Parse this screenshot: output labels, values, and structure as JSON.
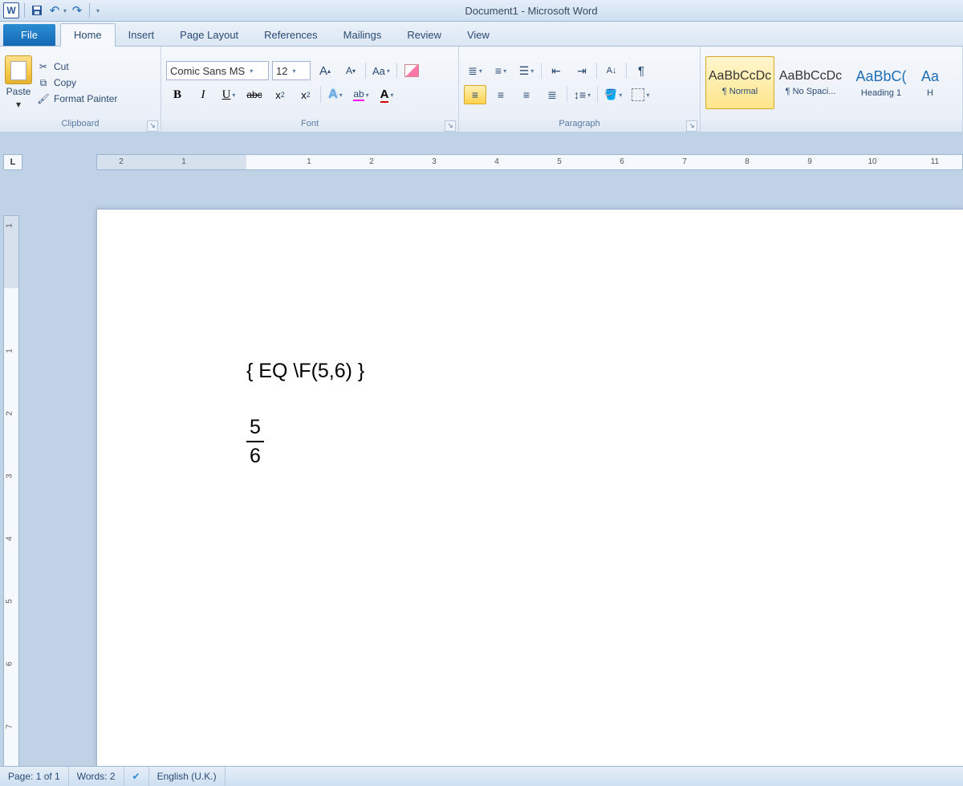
{
  "app": {
    "title": "Document1 - Microsoft Word"
  },
  "qat": {
    "word_letter": "W"
  },
  "tabs": {
    "file": "File",
    "items": [
      "Home",
      "Insert",
      "Page Layout",
      "References",
      "Mailings",
      "Review",
      "View"
    ],
    "active_index": 0
  },
  "clipboard": {
    "paste": "Paste",
    "cut": "Cut",
    "copy": "Copy",
    "format_painter": "Format Painter",
    "group_label": "Clipboard"
  },
  "font": {
    "name": "Comic Sans MS",
    "size": "12",
    "grow": "A",
    "shrink": "A",
    "case": "Aa",
    "bold": "B",
    "italic": "I",
    "underline": "U",
    "strike": "abc",
    "sub": "x",
    "sup": "x",
    "textfx": "A",
    "highlight": "ab",
    "color": "A",
    "group_label": "Font"
  },
  "paragraph": {
    "group_label": "Paragraph",
    "pilcrow": "¶"
  },
  "styles": {
    "sample": "AaBbCcDc",
    "sample_heading": "AaBbC(",
    "sample_heading2": "Aa",
    "normal": "¶ Normal",
    "nospacing": "¶ No Spaci...",
    "heading1": "Heading 1",
    "heading2": "H"
  },
  "ruler": {
    "tab_stop": "L"
  },
  "document": {
    "field_code": "{ EQ \\F(5,6) }",
    "fraction": {
      "numerator": "5",
      "denominator": "6"
    }
  },
  "status": {
    "page": "Page: 1 of 1",
    "words": "Words: 2",
    "language": "English (U.K.)"
  }
}
